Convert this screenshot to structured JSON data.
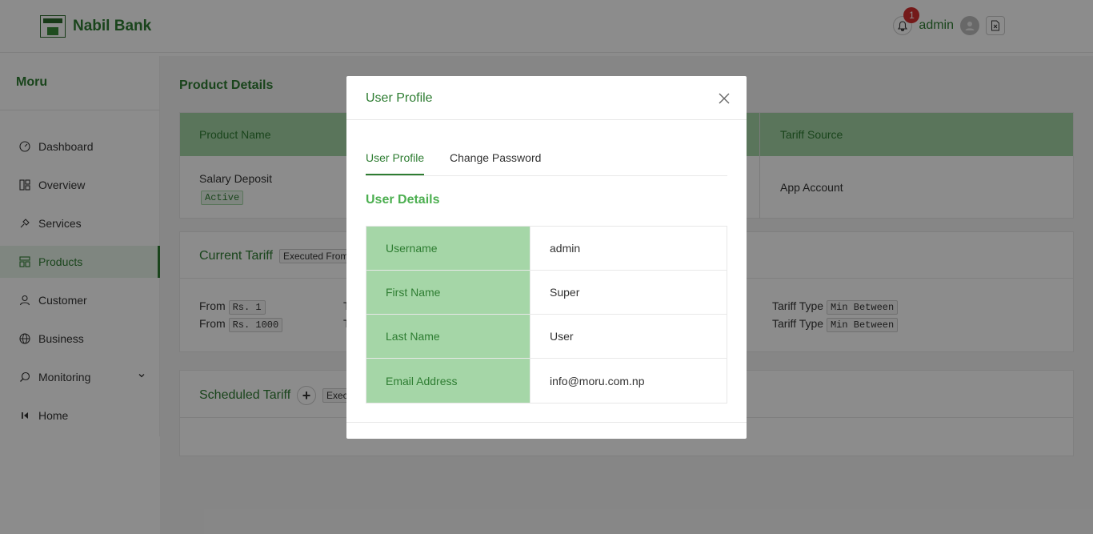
{
  "header": {
    "brand": "Nabil Bank",
    "notification_count": "1",
    "username": "admin"
  },
  "sidebar": {
    "title": "Moru",
    "items": [
      {
        "label": "Dashboard",
        "icon": "dashboard-icon"
      },
      {
        "label": "Overview",
        "icon": "overview-icon"
      },
      {
        "label": "Services",
        "icon": "services-icon"
      },
      {
        "label": "Products",
        "icon": "products-icon",
        "active": true
      },
      {
        "label": "Customer",
        "icon": "user-icon"
      },
      {
        "label": "Business",
        "icon": "globe-icon"
      },
      {
        "label": "Monitoring",
        "icon": "search-icon"
      },
      {
        "label": "Home",
        "icon": "home-icon"
      }
    ]
  },
  "main": {
    "page_title": "Product Details",
    "product_table": {
      "headers": [
        "Product Name",
        "Tariff Source"
      ],
      "row": {
        "name": "Salary Deposit",
        "status": "Active",
        "tariff_source": "App Account"
      }
    },
    "current_tariff": {
      "title": "Current Tariff",
      "executed_label": "Executed From",
      "rows": [
        {
          "from_label": "From",
          "from_value": "Rs. 1",
          "to_label": "T",
          "type_label": "Tariff Type",
          "type_value": "Min Between"
        },
        {
          "from_label": "From",
          "from_value": "Rs. 1000",
          "to_label": "T",
          "type_label": "Tariff Type",
          "type_value": "Min Between"
        }
      ]
    },
    "scheduled_tariff": {
      "title": "Scheduled Tariff",
      "plus": "+",
      "executed_label": "Exec"
    }
  },
  "modal": {
    "title": "User Profile",
    "tabs": [
      "User Profile",
      "Change Password"
    ],
    "details_title": "User Details",
    "fields": [
      {
        "label": "Username",
        "value": "admin"
      },
      {
        "label": "First Name",
        "value": "Super"
      },
      {
        "label": "Last Name",
        "value": "User"
      },
      {
        "label": "Email Address",
        "value": "info@moru.com.np"
      }
    ]
  },
  "colors": {
    "brand_green": "#2e7d32",
    "table_header_green": "#a5d6a7",
    "badge_red": "#d32f2f"
  }
}
